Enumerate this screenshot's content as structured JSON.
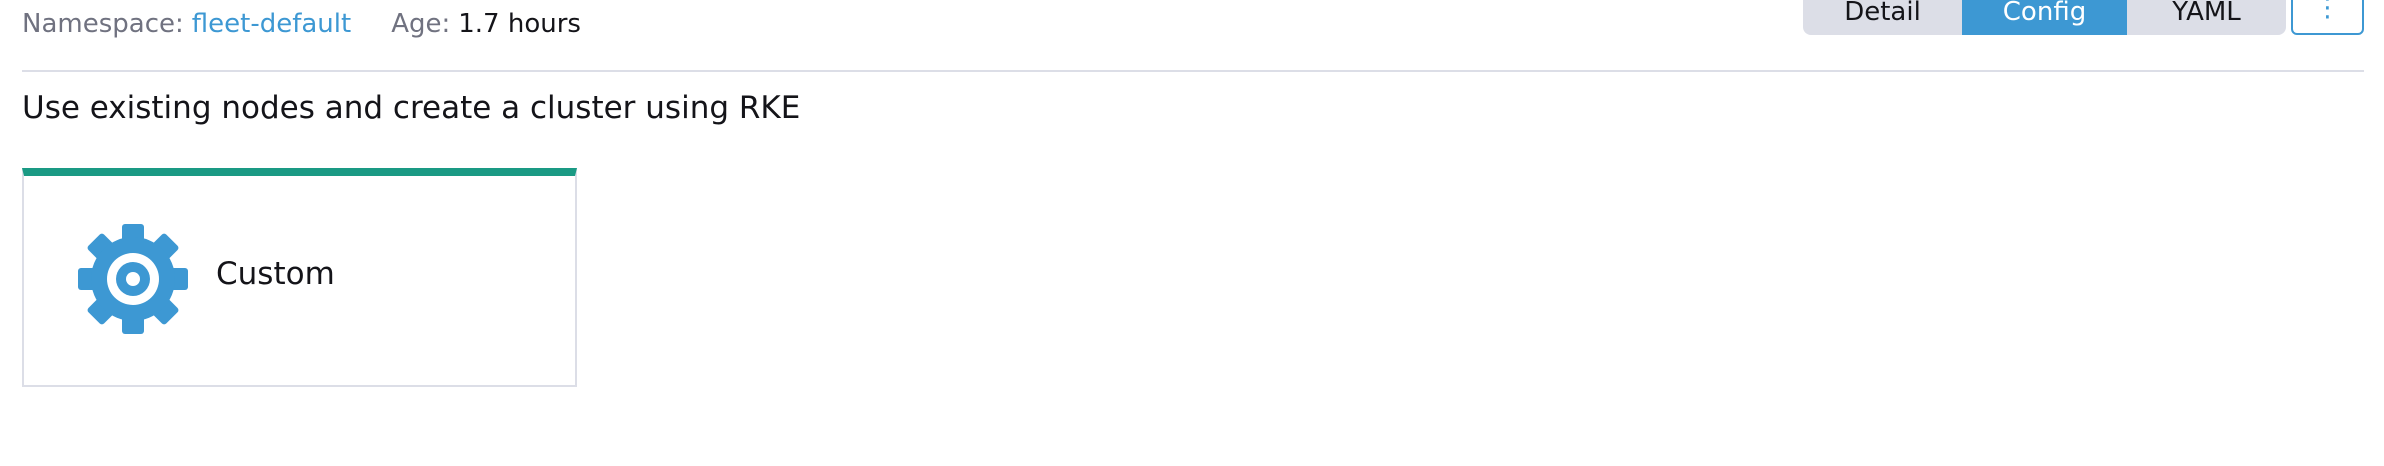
{
  "meta": {
    "namespace_label": "Namespace:",
    "namespace_value": "fleet-default",
    "age_label": "Age:",
    "age_value": "1.7 hours"
  },
  "view_toggle": {
    "buttons": [
      {
        "label": "Detail",
        "active": false
      },
      {
        "label": "Config",
        "active": true
      },
      {
        "label": "YAML",
        "active": false
      }
    ],
    "actions_label": "⋮"
  },
  "section": {
    "title": "Use existing nodes and create a cluster using RKE"
  },
  "tiles": [
    {
      "label": "Custom",
      "icon": "gear-icon"
    }
  ],
  "colors": {
    "accent_blue": "#3d98d3",
    "tile_top_border": "#1a9a84",
    "muted_text": "#707280",
    "segment_bg": "#dcdee7"
  }
}
